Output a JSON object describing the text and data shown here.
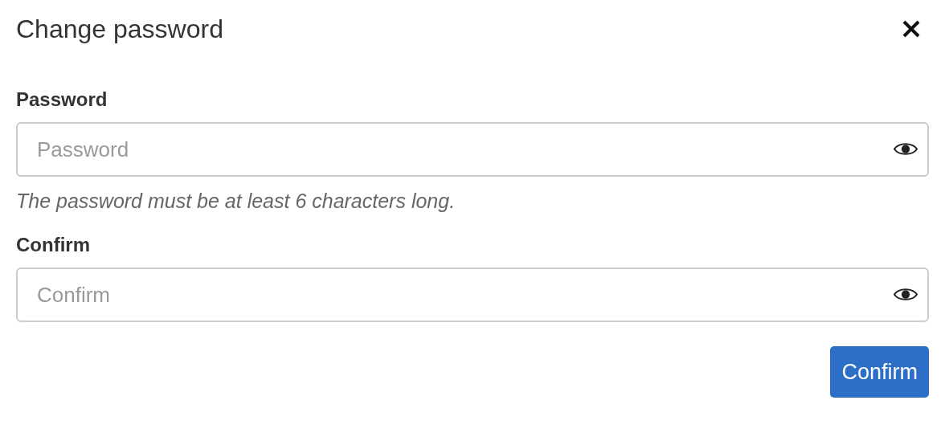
{
  "dialog": {
    "title": "Change password"
  },
  "fields": [
    {
      "label": "Password",
      "placeholder": "Password",
      "hint": "The password must be at least 6 characters long."
    },
    {
      "label": "Confirm",
      "placeholder": "Confirm"
    }
  ],
  "buttons": [
    {
      "label": "Confirm"
    }
  ]
}
